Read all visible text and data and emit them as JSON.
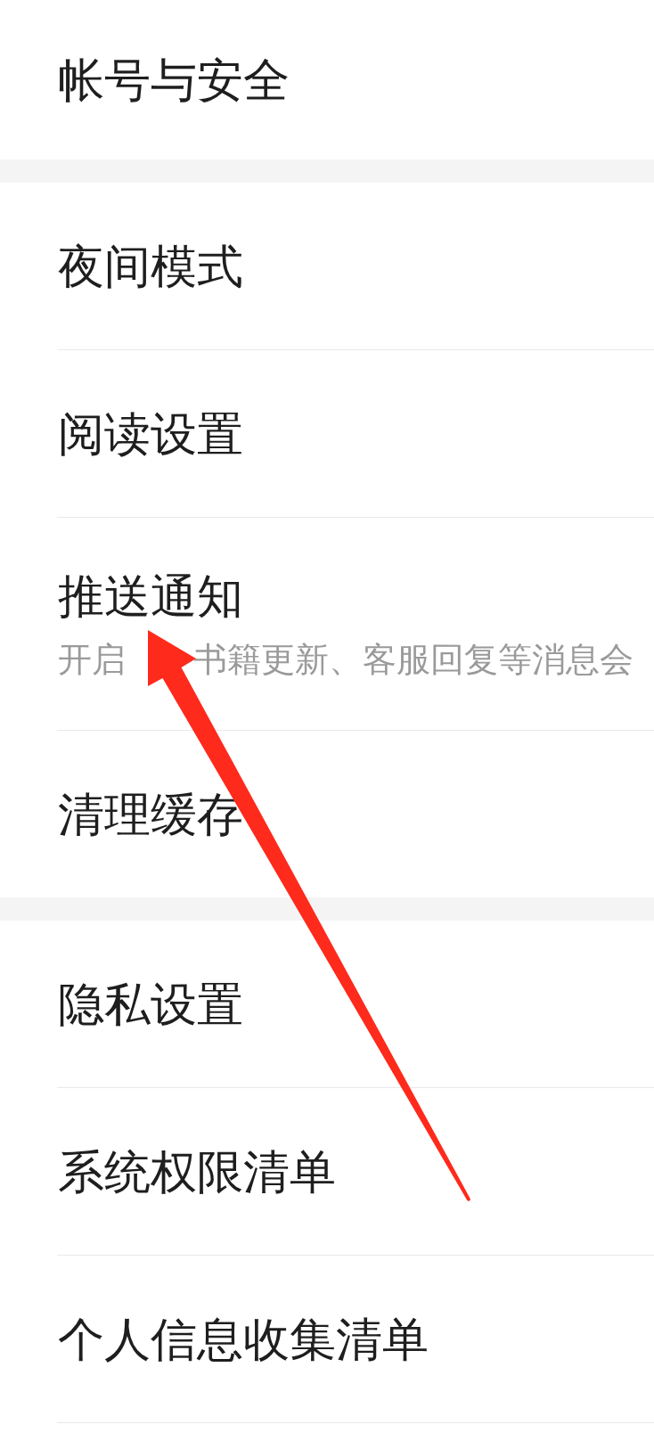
{
  "groups": [
    {
      "items": [
        {
          "label": "帐号与安全"
        }
      ]
    },
    {
      "items": [
        {
          "label": "夜间模式"
        },
        {
          "label": "阅读设置"
        },
        {
          "label": "推送通知",
          "description": [
            "开启",
            "书籍更新、客服回复等消息会"
          ]
        },
        {
          "label": "清理缓存"
        }
      ]
    },
    {
      "items": [
        {
          "label": "隐私设置"
        },
        {
          "label": "系统权限清单"
        },
        {
          "label": "个人信息收集清单"
        }
      ]
    }
  ],
  "annotation": {
    "kind": "arrow"
  }
}
